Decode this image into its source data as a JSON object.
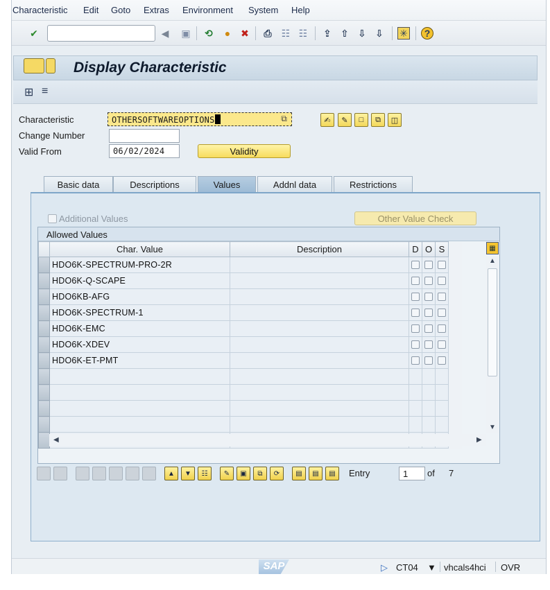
{
  "menu": [
    "Characteristic",
    "Edit",
    "Goto",
    "Extras",
    "Environment",
    "System",
    "Help"
  ],
  "toolbar": {
    "command_value": "",
    "icons": [
      "enter-icon",
      "back-arrow-icon",
      "save-icon",
      "back-icon",
      "exit-icon",
      "cancel-icon",
      "print-icon",
      "find-icon",
      "find-next-icon",
      "first-page-icon",
      "prev-page-icon",
      "next-page-icon",
      "last-page-icon",
      "create-session-icon",
      "help-icon"
    ]
  },
  "title": "Display Characteristic",
  "form": {
    "characteristic_label": "Characteristic",
    "characteristic_value": "OTHERSOFTWAREOPTIONS",
    "change_number_label": "Change Number",
    "change_number_value": "",
    "valid_from_label": "Valid From",
    "valid_from_value": "06/02/2024",
    "validity_button": "Validity"
  },
  "tabs": [
    {
      "label": "Basic data",
      "active": false
    },
    {
      "label": "Descriptions",
      "active": false
    },
    {
      "label": "Values",
      "active": true
    },
    {
      "label": "Addnl data",
      "active": false
    },
    {
      "label": "Restrictions",
      "active": false
    }
  ],
  "values_tab": {
    "additional_values_label": "Additional Values",
    "other_value_check_button": "Other Value Check",
    "grid_title": "Allowed Values",
    "columns": [
      "Char. Value",
      "Description",
      "D",
      "O",
      "S"
    ],
    "rows": [
      {
        "value": "HDO6K-SPECTRUM-PRO-2R",
        "description": ""
      },
      {
        "value": "HDO6K-Q-SCAPE",
        "description": ""
      },
      {
        "value": "HDO6KB-AFG",
        "description": ""
      },
      {
        "value": "HDO6K-SPECTRUM-1",
        "description": ""
      },
      {
        "value": "HDO6K-EMC",
        "description": ""
      },
      {
        "value": "HDO6K-XDEV",
        "description": ""
      },
      {
        "value": "HDO6K-ET-PMT",
        "description": ""
      }
    ],
    "empty_rows": 5,
    "entry_label": "Entry",
    "entry_value": "1",
    "of_label": "of",
    "total": "7"
  },
  "status": {
    "logo": "SAP",
    "transaction": "CT04",
    "server": "vhcals4hci",
    "mode": "OVR"
  },
  "colors": {
    "accent_yellow": "#f7dc5d",
    "panel_blue": "#dde8f1",
    "active_tab": "#9cbad5"
  }
}
